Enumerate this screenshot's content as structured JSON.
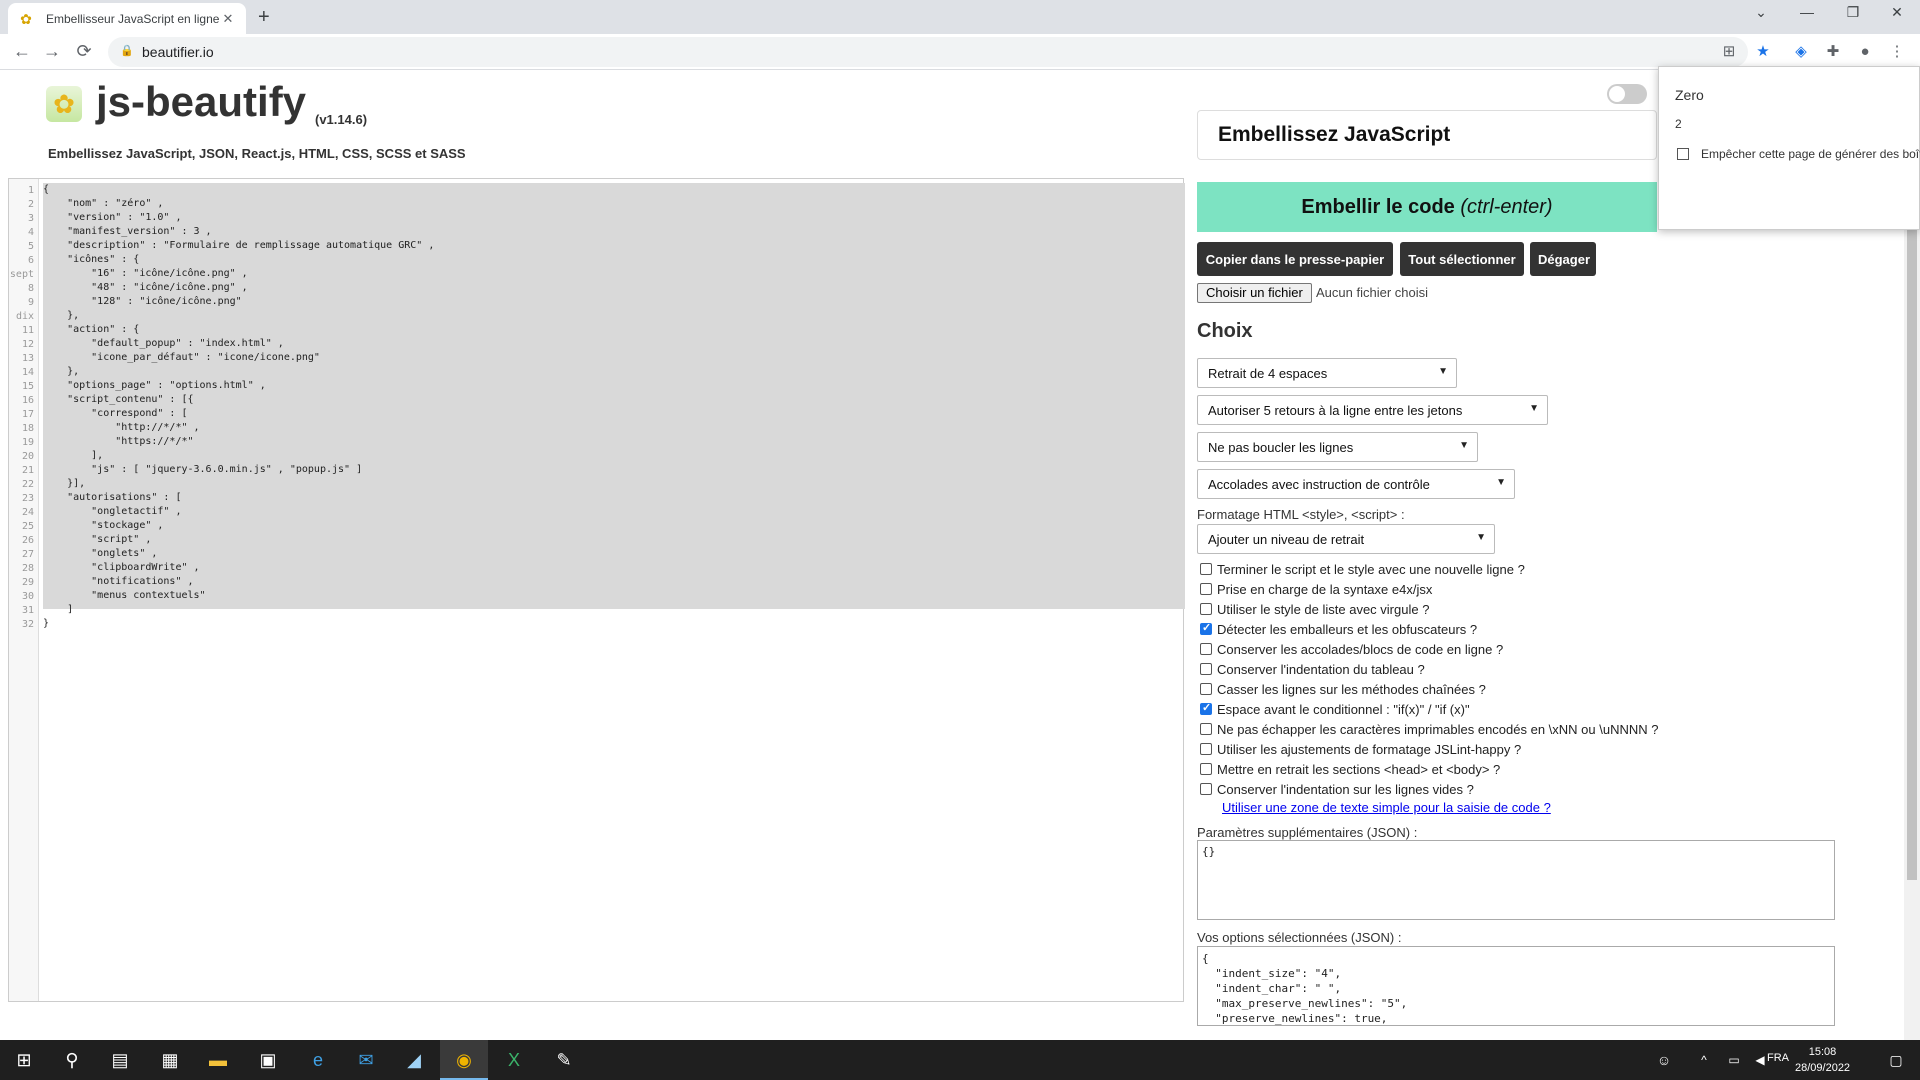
{
  "browser": {
    "tab_title": "Embellisseur JavaScript en ligne",
    "url": "beautifier.io",
    "new_tab": "+",
    "nav_back": "←",
    "nav_forward": "→",
    "nav_reload": "⟳"
  },
  "header": {
    "brand": "js-beautify",
    "version": "(v1.14.6)",
    "subtitle": "Embellissez JavaScript, JSON, React.js, HTML, CSS, SCSS et SASS"
  },
  "editor": {
    "line_numbers": [
      "1",
      "2",
      "3",
      "4",
      "5",
      "6",
      "sept",
      "8",
      "9",
      "dix",
      "11",
      "12",
      "13",
      "14",
      "15",
      "16",
      "17",
      "18",
      "19",
      "20",
      "21",
      "22",
      "23",
      "24",
      "25",
      "26",
      "27",
      "28",
      "29",
      "30",
      "31",
      "32"
    ],
    "lines": [
      "{",
      "    \"nom\" : \"zéro\" ,",
      "    \"version\" : \"1.0\" ,",
      "    \"manifest_version\" : 3 ,",
      "    \"description\" : \"Formulaire de remplissage automatique GRC\" ,",
      "    \"icônes\" : {",
      "        \"16\" : \"icône/icône.png\" ,",
      "        \"48\" : \"icône/icône.png\" ,",
      "        \"128\" : \"icône/icône.png\"",
      "    },",
      "    \"action\" : {",
      "        \"default_popup\" : \"index.html\" ,",
      "        \"icone_par_défaut\" : \"icone/icone.png\"",
      "    },",
      "    \"options_page\" : \"options.html\" ,",
      "    \"script_contenu\" : [{",
      "        \"correspond\" : [",
      "            \"http://*/*\" ,",
      "            \"https://*/*\"",
      "        ],",
      "        \"js\" : [ \"jquery-3.6.0.min.js\" , \"popup.js\" ]",
      "    }],",
      "    \"autorisations\" : [",
      "        \"ongletactif\" ,",
      "        \"stockage\" ,",
      "        \"script\" ,",
      "        \"onglets\" ,",
      "        \"clipboardWrite\" ,",
      "        \"notifications\" ,",
      "        \"menus contextuels\"",
      "    ]",
      "}"
    ]
  },
  "panel": {
    "language_title": "Embellissez JavaScript",
    "beautify_label": "Embellir le code",
    "beautify_shortcut": "(ctrl-enter)",
    "copy_label": "Copier dans le presse-papier",
    "select_all_label": "Tout sélectionner",
    "clear_label": "Dégager",
    "file_button": "Choisir un fichier",
    "no_file": "Aucun fichier choisi",
    "options_heading": "Choix",
    "selects": [
      "Retrait de 4 espaces",
      "Autoriser 5 retours à la ligne entre les jetons",
      "Ne pas boucler les lignes",
      "Accolades avec instruction de contrôle"
    ],
    "html_format_label": "Formatage HTML <style>, <script> :",
    "html_format_value": "Ajouter un niveau de retrait",
    "checkboxes": [
      {
        "label": "Terminer le script et le style avec une nouvelle ligne ?",
        "checked": false
      },
      {
        "label": "Prise en charge de la syntaxe e4x/jsx",
        "checked": false
      },
      {
        "label": "Utiliser le style de liste avec virgule ?",
        "checked": false
      },
      {
        "label": "Détecter les emballeurs et les obfuscateurs ?",
        "checked": true
      },
      {
        "label": "Conserver les accolades/blocs de code en ligne ?",
        "checked": false
      },
      {
        "label": "Conserver l'indentation du tableau ?",
        "checked": false
      },
      {
        "label": "Casser les lignes sur les méthodes chaînées ?",
        "checked": false
      },
      {
        "label": "Espace avant le conditionnel : \"if(x)\" / \"if (x)\"",
        "checked": true
      },
      {
        "label": "Ne pas échapper les caractères imprimables encodés en \\xNN ou \\uNNNN ?",
        "checked": false
      },
      {
        "label": "Utiliser les ajustements de formatage JSLint-happy ?",
        "checked": false
      },
      {
        "label": "Mettre en retrait les sections <head> et <body> ?",
        "checked": false
      },
      {
        "label": "Conserver l'indentation sur les lignes vides ?",
        "checked": false
      }
    ],
    "plain_textarea_link": "Utiliser une zone de texte simple pour la saisie de code ?",
    "extra_label": "Paramètres supplémentaires (JSON) :",
    "extra_value": "{}",
    "selected_label": "Vos options sélectionnées (JSON) :",
    "selected_value": "{\n  \"indent_size\": \"4\",\n  \"indent_char\": \" \",\n  \"max_preserve_newlines\": \"5\",\n  \"preserve_newlines\": true,"
  },
  "popup": {
    "title": "Zero",
    "count": "2",
    "checkbox_label": "Empêcher cette page de générer des boîtes de dialogue"
  },
  "taskbar": {
    "lang": "FRA",
    "time": "15:08",
    "date": "28/09/2022"
  },
  "colors": {
    "beautify_button": "#7de3c2",
    "dark_button": "#333333",
    "selection": "#d9d9d9"
  }
}
